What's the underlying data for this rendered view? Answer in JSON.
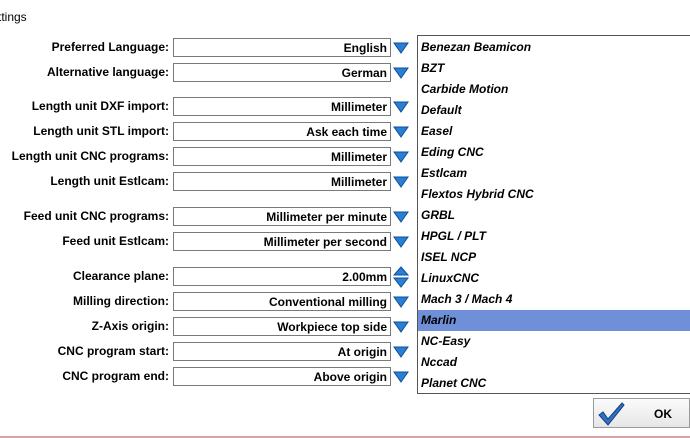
{
  "window": {
    "title": "ttings"
  },
  "settings": [
    {
      "label": "Preferred Language:",
      "value": "English",
      "control": "dropdown"
    },
    {
      "label": "Alternative language:",
      "value": "German",
      "control": "dropdown"
    },
    {
      "label": "Length unit DXF import:",
      "value": "Millimeter",
      "control": "dropdown"
    },
    {
      "label": "Length unit STL import:",
      "value": "Ask each time",
      "control": "dropdown"
    },
    {
      "label": "Length unit CNC programs:",
      "value": "Millimeter",
      "control": "dropdown"
    },
    {
      "label": "Length unit Estlcam:",
      "value": "Millimeter",
      "control": "dropdown"
    },
    {
      "label": "Feed unit CNC programs:",
      "value": "Millimeter per minute",
      "control": "dropdown"
    },
    {
      "label": "Feed unit Estlcam:",
      "value": "Millimeter per second",
      "control": "dropdown"
    },
    {
      "label": "Clearance plane:",
      "value": "2.00mm",
      "control": "spinner"
    },
    {
      "label": "Milling direction:",
      "value": "Conventional milling",
      "control": "dropdown"
    },
    {
      "label": "Z-Axis origin:",
      "value": "Workpiece top side",
      "control": "dropdown"
    },
    {
      "label": "CNC program start:",
      "value": "At origin",
      "control": "dropdown"
    },
    {
      "label": "CNC program end:",
      "value": "Above origin",
      "control": "dropdown"
    }
  ],
  "controllers": {
    "items": [
      "Benezan Beamicon",
      "BZT",
      "Carbide Motion",
      "Default",
      "Easel",
      "Eding CNC",
      "Estlcam",
      "Flextos Hybrid CNC",
      "GRBL",
      "HPGL / PLT",
      "ISEL NCP",
      "LinuxCNC",
      "Mach 3 / Mach 4",
      "Marlin",
      "NC-Easy",
      "Nccad",
      "Planet CNC"
    ],
    "selected": "Marlin"
  },
  "ok_button": {
    "label": "OK"
  },
  "colors": {
    "arrow_blue": "#2a7fd4",
    "selection": "#6f8fd9"
  }
}
